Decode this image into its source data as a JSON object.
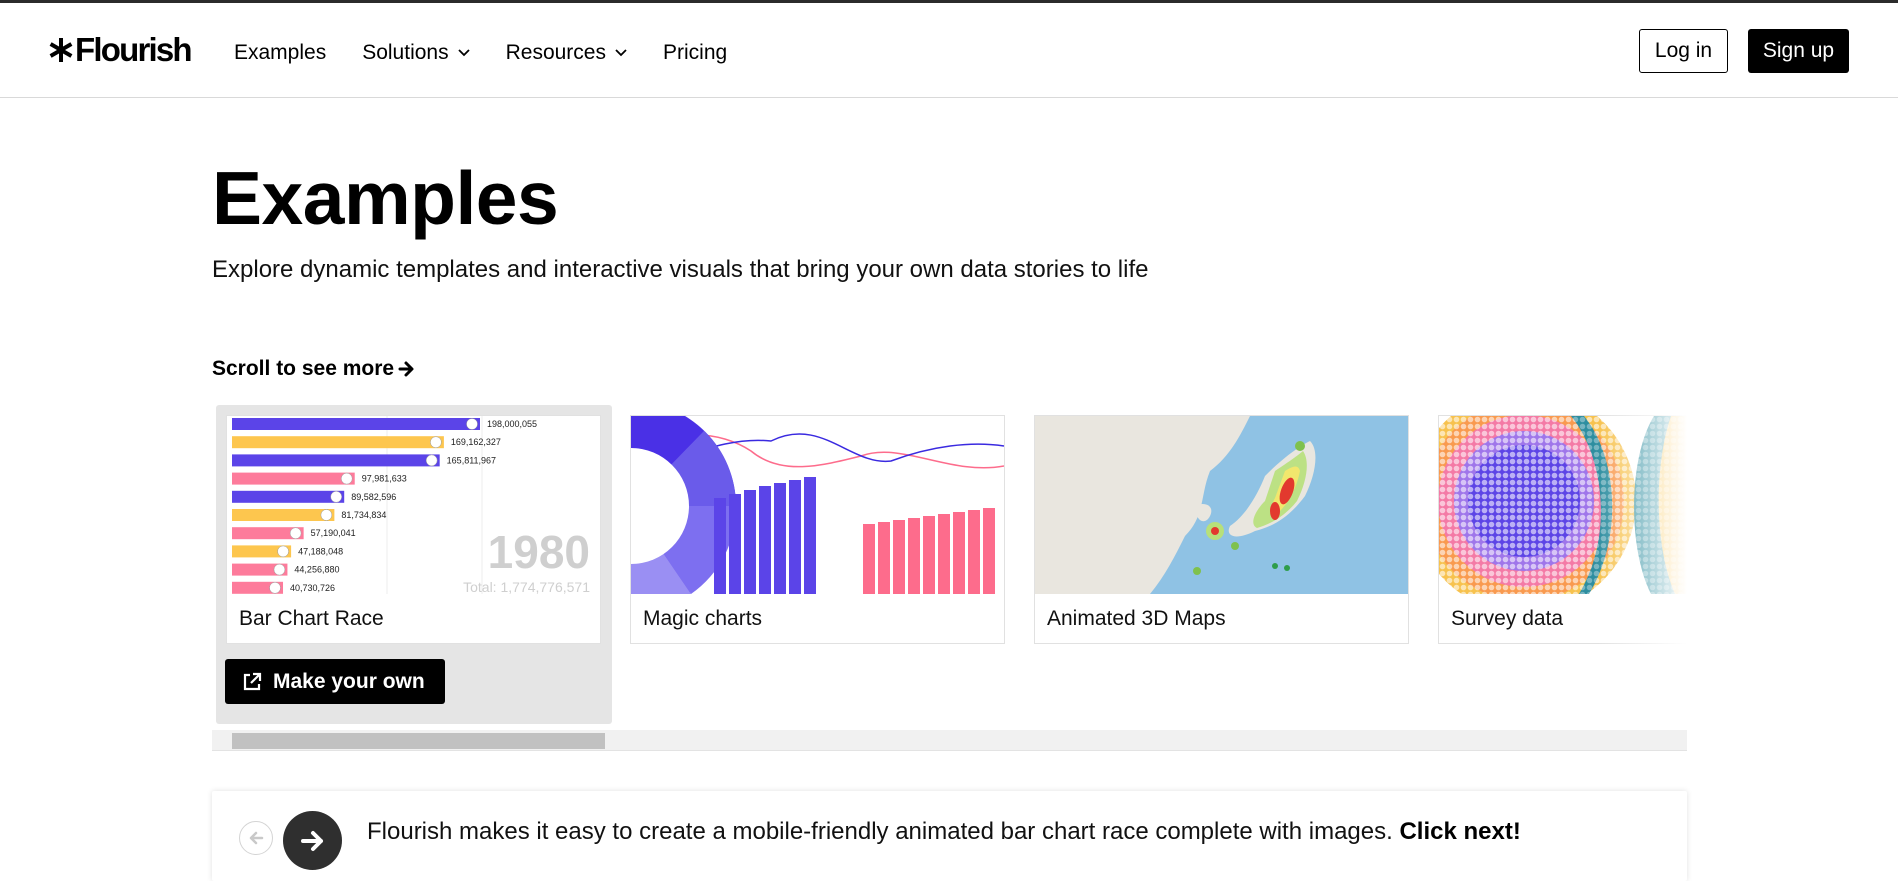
{
  "header": {
    "logo_text": "Flourish",
    "nav": [
      {
        "label": "Examples",
        "dropdown": false
      },
      {
        "label": "Solutions",
        "dropdown": true
      },
      {
        "label": "Resources",
        "dropdown": true
      },
      {
        "label": "Pricing",
        "dropdown": false
      }
    ],
    "login_label": "Log in",
    "signup_label": "Sign up"
  },
  "page": {
    "title": "Examples",
    "subtitle": "Explore dynamic templates and interactive visuals that bring your own data stories to life",
    "scroll_hint": "Scroll to see more"
  },
  "carousel": {
    "cards": [
      {
        "label": "Bar Chart Race",
        "active": true,
        "icon": "bar-chart-race-thumbnail"
      },
      {
        "label": "Magic charts",
        "active": false,
        "icon": "magic-charts-thumbnail"
      },
      {
        "label": "Animated 3D Maps",
        "active": false,
        "icon": "heat-map-thumbnail"
      },
      {
        "label": "Survey data",
        "active": false,
        "icon": "dot-cluster-thumbnail"
      }
    ],
    "make_your_own_label": "Make your own",
    "bar_race": {
      "year": "1980",
      "total": "Total: 1,774,776,571",
      "values": [
        "198,000,055",
        "169,162,327",
        "165,811,967",
        "97,981,633",
        "89,582,596",
        "81,734,834",
        "57,190,041",
        "47,188,048",
        "44,256,880",
        "40,730,726"
      ],
      "magnitudes": [
        198000055,
        169162327,
        165811967,
        97981633,
        89582596,
        81734834,
        57190041,
        47188048,
        44256880,
        40730726
      ],
      "colors": [
        "#5b44e8",
        "#fdc64e",
        "#5b44e8",
        "#fd7b9b",
        "#5b44e8",
        "#fdc64e",
        "#fd7b9b",
        "#fdc64e",
        "#fd7b9b",
        "#fd7b9b"
      ]
    }
  },
  "promo": {
    "text": "Flourish makes it easy to create a mobile-friendly animated bar chart race complete with images.",
    "cta": "Click next!"
  },
  "colors": {
    "accent_purple": "#5b44e8",
    "accent_pink": "#fd6c8c",
    "accent_yellow": "#fdc64e",
    "button_dark": "#000000"
  }
}
